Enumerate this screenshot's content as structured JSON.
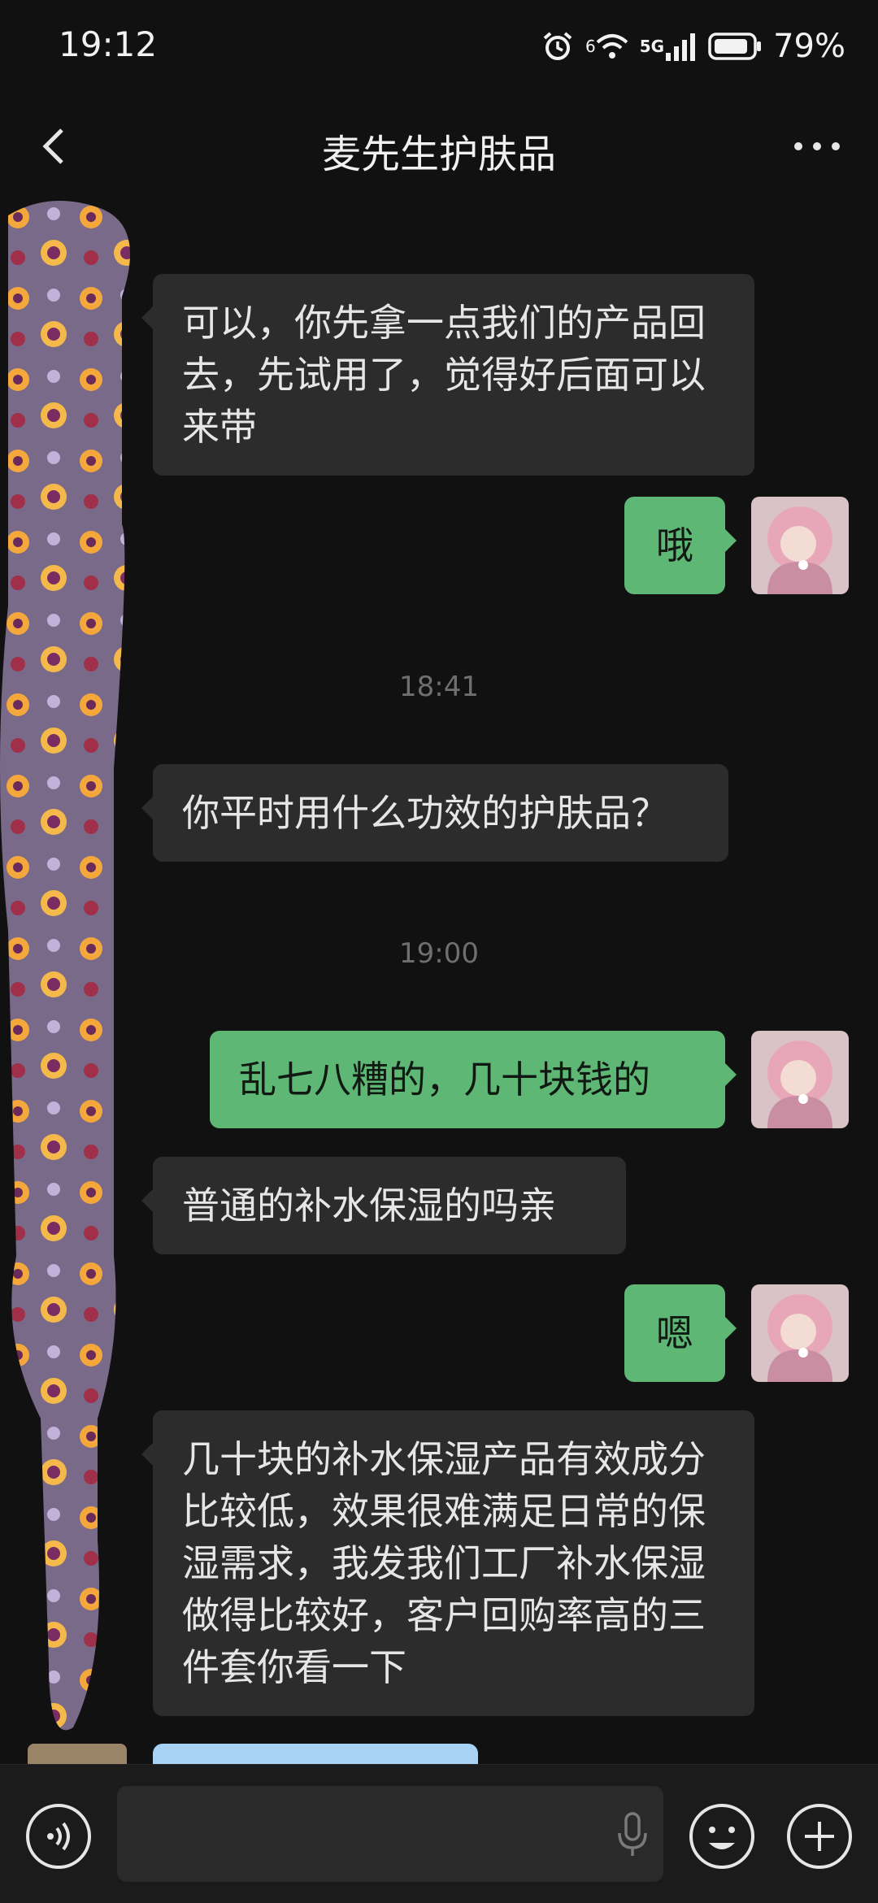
{
  "status_bar": {
    "time": "19:12",
    "battery": "79%",
    "network": "5G",
    "wifi_badge": "6",
    "icons": [
      "alarm-icon",
      "wifi-icon",
      "signal-icon",
      "battery-icon"
    ]
  },
  "header": {
    "title": "麦先生护肤品",
    "back_icon": "chevron-left-icon",
    "more_icon": "more-dots-icon"
  },
  "messages": [
    {
      "side": "in",
      "text": "可以，你先拿一点我们的产品回去，先试用了，觉得好后面可以来带"
    },
    {
      "side": "out",
      "text": "哦"
    },
    {
      "type": "time",
      "text": "18:41"
    },
    {
      "side": "in",
      "text": "你平时用什么功效的护肤品？"
    },
    {
      "type": "time",
      "text": "19:00"
    },
    {
      "side": "out",
      "text": "乱七八糟的，几十块钱的"
    },
    {
      "side": "in",
      "text": "普通的补水保湿的吗亲"
    },
    {
      "side": "out",
      "text": "嗯"
    },
    {
      "side": "in",
      "text": "几十块的补水保湿产品有效成分比较低，效果很难满足日常的保湿需求，我发我们工厂补水保湿做得比较好，客户回购率高的三件套你看一下"
    }
  ],
  "input_bar": {
    "icons": [
      "voice-icon",
      "microphone-icon",
      "emoji-icon",
      "plus-icon"
    ]
  },
  "colors": {
    "background": "#111111",
    "incoming_bubble": "#2c2c2c",
    "outgoing_bubble": "#5eb775"
  }
}
